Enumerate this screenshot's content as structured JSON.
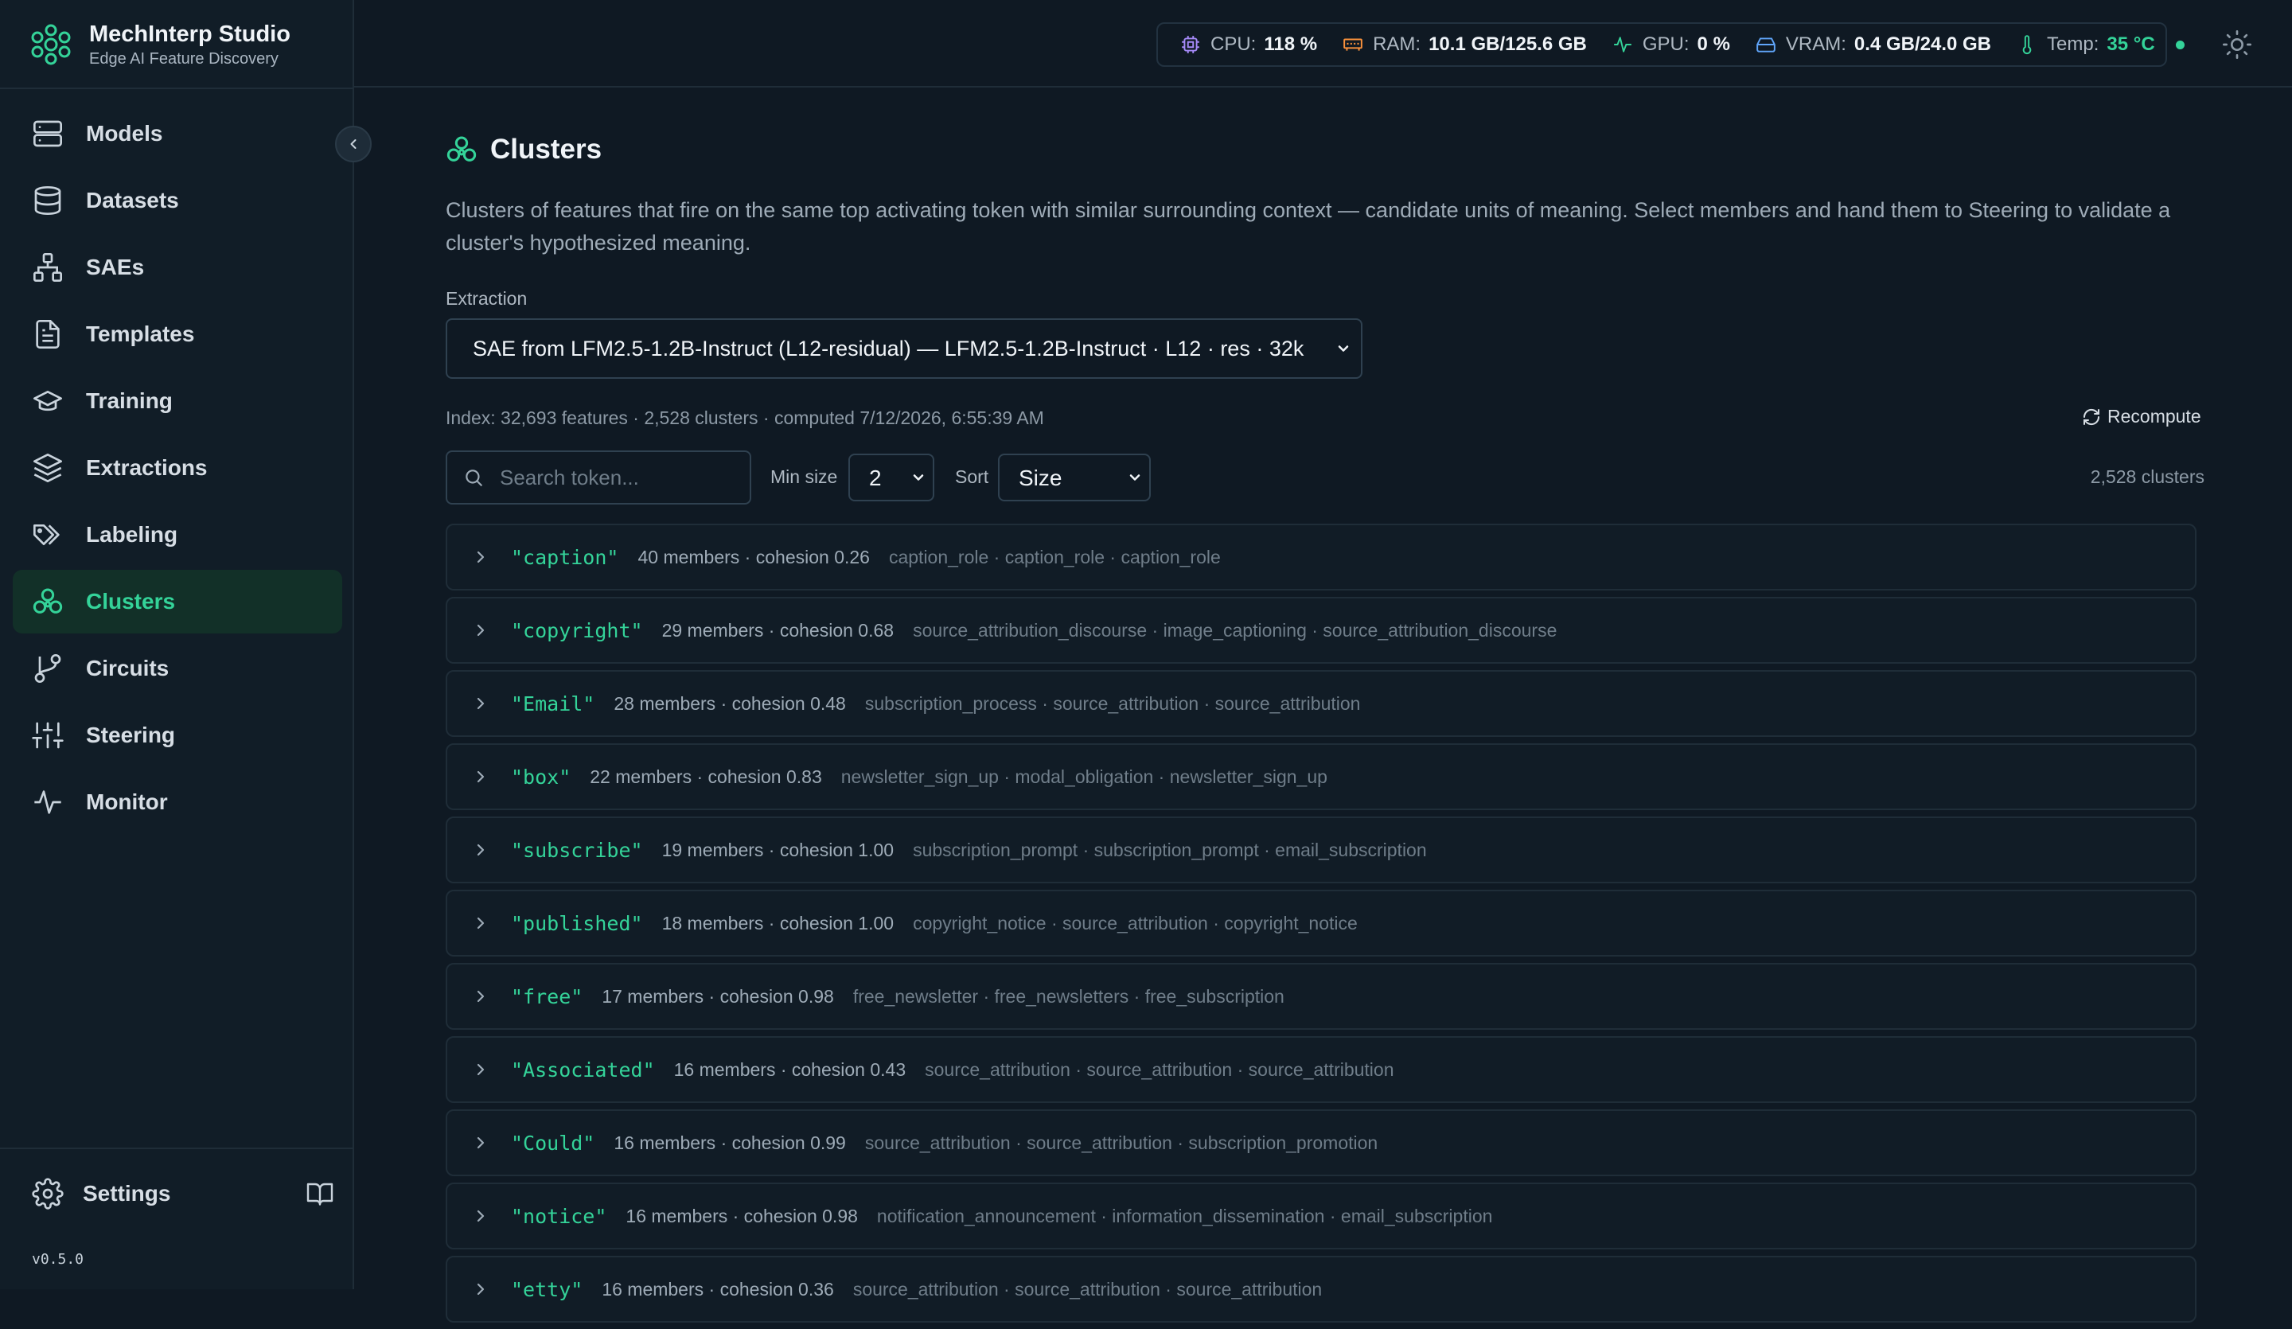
{
  "brand": {
    "title": "MechInterp Studio",
    "subtitle": "Edge AI Feature Discovery"
  },
  "nav": [
    {
      "label": "Models",
      "icon": "server-icon",
      "active": false
    },
    {
      "label": "Datasets",
      "icon": "database-icon",
      "active": false
    },
    {
      "label": "SAEs",
      "icon": "network-icon",
      "active": false
    },
    {
      "label": "Templates",
      "icon": "file-text-icon",
      "active": false
    },
    {
      "label": "Training",
      "icon": "graduation-cap-icon",
      "active": false
    },
    {
      "label": "Extractions",
      "icon": "layers-icon",
      "active": false
    },
    {
      "label": "Labeling",
      "icon": "tags-icon",
      "active": false
    },
    {
      "label": "Clusters",
      "icon": "clusters-icon",
      "active": true
    },
    {
      "label": "Circuits",
      "icon": "git-branch-icon",
      "active": false
    },
    {
      "label": "Steering",
      "icon": "sliders-icon",
      "active": false
    },
    {
      "label": "Monitor",
      "icon": "activity-icon",
      "active": false
    }
  ],
  "settings_label": "Settings",
  "version": "v0.5.0",
  "stats": {
    "cpu_label": "CPU:",
    "cpu_value": "118 %",
    "ram_label": "RAM:",
    "ram_value": "10.1 GB/125.6 GB",
    "gpu_label": "GPU:",
    "gpu_value": "0 %",
    "vram_label": "VRAM:",
    "vram_value": "0.4 GB/24.0 GB",
    "temp_label": "Temp:",
    "temp_value": "35 °C"
  },
  "page": {
    "title": "Clusters",
    "description": "Clusters of features that fire on the same top activating token with similar surrounding context — candidate units of meaning. Select members and hand them to Steering to validate a cluster's hypothesized meaning.",
    "extraction_label": "Extraction",
    "extraction_value": "SAE from LFM2.5-1.2B-Instruct (L12-residual) — LFM2.5-1.2B-Instruct · L12 · res · 32k",
    "index_line": "Index: 32,693 features · 2,528 clusters · computed 7/12/2026, 6:55:39 AM",
    "recompute_label": "Recompute",
    "search_placeholder": "Search token...",
    "min_size_label": "Min size",
    "min_size_value": "2",
    "sort_label": "Sort",
    "sort_value": "Size",
    "cluster_count": "2,528 clusters"
  },
  "clusters": [
    {
      "token": "\"caption\"",
      "meta": "40 members · cohesion 0.26",
      "labels": "caption_role · caption_role · caption_role"
    },
    {
      "token": "\"copyright\"",
      "meta": "29 members · cohesion 0.68",
      "labels": "source_attribution_discourse · image_captioning · source_attribution_discourse"
    },
    {
      "token": "\"Email\"",
      "meta": "28 members · cohesion 0.48",
      "labels": "subscription_process · source_attribution · source_attribution"
    },
    {
      "token": "\"box\"",
      "meta": "22 members · cohesion 0.83",
      "labels": "newsletter_sign_up · modal_obligation · newsletter_sign_up"
    },
    {
      "token": "\"subscribe\"",
      "meta": "19 members · cohesion 1.00",
      "labels": "subscription_prompt · subscription_prompt · email_subscription"
    },
    {
      "token": "\"published\"",
      "meta": "18 members · cohesion 1.00",
      "labels": "copyright_notice · source_attribution · copyright_notice"
    },
    {
      "token": "\"free\"",
      "meta": "17 members · cohesion 0.98",
      "labels": "free_newsletter · free_newsletters · free_subscription"
    },
    {
      "token": "\"Associated\"",
      "meta": "16 members · cohesion 0.43",
      "labels": "source_attribution · source_attribution · source_attribution"
    },
    {
      "token": "\"Could\"",
      "meta": "16 members · cohesion 0.99",
      "labels": "source_attribution · source_attribution · subscription_promotion"
    },
    {
      "token": "\"notice\"",
      "meta": "16 members · cohesion 0.98",
      "labels": "notification_announcement · information_dissemination · email_subscription"
    },
    {
      "token": "\"etty\"",
      "meta": "16 members · cohesion 0.36",
      "labels": "source_attribution · source_attribution · source_attribution"
    }
  ],
  "colors": {
    "accent": "#34d399",
    "background": "#0f1923",
    "sidebar": "#111d27"
  }
}
